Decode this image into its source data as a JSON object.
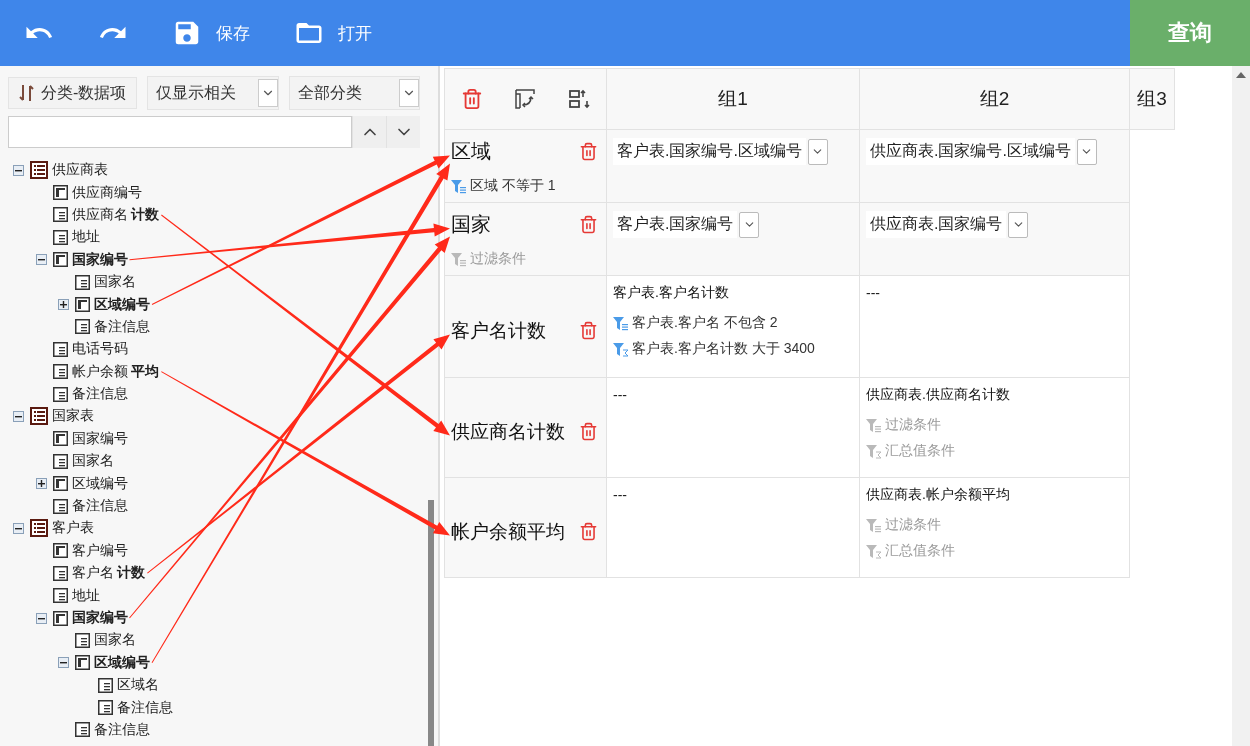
{
  "toolbar": {
    "buttons": [
      {
        "kind": "undo"
      },
      {
        "kind": "redo"
      },
      {
        "kind": "save",
        "label": "保存"
      },
      {
        "kind": "open",
        "label": "打开"
      }
    ],
    "query_button": "查询"
  },
  "left_panel": {
    "category_button": "分类-数据项",
    "filter_select": "仅显示相关",
    "category_select": "全部分类",
    "tree": [
      {
        "kind": "table",
        "label": "供应商表",
        "highlighted": false,
        "expanded": true,
        "children": [
          {
            "kind": "key",
            "label": "供应商编号",
            "highlighted": false
          },
          {
            "kind": "field",
            "label": "供应商名 **计数**",
            "highlighted": false
          },
          {
            "kind": "field",
            "label": "地址",
            "highlighted": false
          },
          {
            "kind": "key",
            "label": "国家编号",
            "highlighted": true,
            "expanded": true,
            "children": [
              {
                "kind": "field",
                "label": "国家名",
                "highlighted": false
              },
              {
                "kind": "key",
                "label": "区域编号",
                "highlighted": true,
                "expanded": false
              },
              {
                "kind": "field",
                "label": "备注信息",
                "highlighted": false
              }
            ]
          },
          {
            "kind": "field",
            "label": "电话号码",
            "highlighted": false
          },
          {
            "kind": "field",
            "label": "帐户余额 **平均**",
            "highlighted": false
          },
          {
            "kind": "field",
            "label": "备注信息",
            "highlighted": false
          }
        ]
      },
      {
        "kind": "table",
        "label": "国家表",
        "highlighted": false,
        "expanded": true,
        "children": [
          {
            "kind": "key",
            "label": "国家编号",
            "highlighted": false
          },
          {
            "kind": "field",
            "label": "国家名",
            "highlighted": false
          },
          {
            "kind": "key",
            "label": "区域编号",
            "highlighted": false,
            "expanded": false
          },
          {
            "kind": "field",
            "label": "备注信息",
            "highlighted": false
          }
        ]
      },
      {
        "kind": "table",
        "label": "客户表",
        "highlighted": false,
        "expanded": true,
        "children": [
          {
            "kind": "key",
            "label": "客户编号",
            "highlighted": false
          },
          {
            "kind": "field",
            "label": "客户名 **计数**",
            "highlighted": false
          },
          {
            "kind": "field",
            "label": "地址",
            "highlighted": false
          },
          {
            "kind": "key",
            "label": "国家编号",
            "highlighted": true,
            "expanded": true,
            "children": [
              {
                "kind": "field",
                "label": "国家名",
                "highlighted": false
              },
              {
                "kind": "key",
                "label": "区域编号",
                "highlighted": true,
                "expanded": true,
                "children": [
                  {
                    "kind": "field",
                    "label": "区域名",
                    "highlighted": false
                  },
                  {
                    "kind": "field",
                    "label": "备注信息",
                    "highlighted": false
                  }
                ]
              },
              {
                "kind": "field",
                "label": "备注信息",
                "highlighted": false
              }
            ]
          }
        ]
      }
    ]
  },
  "grid": {
    "tools": [
      {
        "kind": "delete"
      },
      {
        "kind": "pivot"
      },
      {
        "kind": "sort"
      }
    ],
    "groups": [
      "组1",
      "组2",
      "组3"
    ],
    "rows": [
      {
        "kind": "dimension",
        "label": "区域",
        "filter": {
          "text": "区域 不等于 1",
          "active": true
        },
        "cells": [
          {
            "kind": "select",
            "value": "客户表.国家编号.区域编号"
          },
          {
            "kind": "select",
            "value": "供应商表.国家编号.区域编号"
          }
        ]
      },
      {
        "kind": "dimension",
        "label": "国家",
        "filter": {
          "text": "过滤条件",
          "active": false
        },
        "cells": [
          {
            "kind": "select",
            "value": "客户表.国家编号"
          },
          {
            "kind": "select",
            "value": "供应商表.国家编号"
          }
        ]
      },
      {
        "kind": "measure",
        "label": "客户名计数",
        "cells": [
          {
            "kind": "measure",
            "title": "客户表.客户名计数",
            "filters": [
              {
                "kind": "row",
                "text": "客户表.客户名 不包含 2",
                "active": true
              },
              {
                "kind": "sum",
                "text": "客户表.客户名计数 大于 3400",
                "active": true
              }
            ]
          },
          {
            "kind": "empty",
            "text": "---"
          }
        ]
      },
      {
        "kind": "measure",
        "label": "供应商名计数",
        "cells": [
          {
            "kind": "empty",
            "text": "---"
          },
          {
            "kind": "measure",
            "title": "供应商表.供应商名计数",
            "filters": [
              {
                "kind": "row",
                "text": "过滤条件",
                "active": false
              },
              {
                "kind": "sum",
                "text": "汇总值条件",
                "active": false
              }
            ]
          }
        ]
      },
      {
        "kind": "measure",
        "label": "帐户余额平均",
        "cells": [
          {
            "kind": "empty",
            "text": "---"
          },
          {
            "kind": "measure",
            "title": "供应商表.帐户余额平均",
            "filters": [
              {
                "kind": "row",
                "text": "过滤条件",
                "active": false
              },
              {
                "kind": "sum",
                "text": "汇总值条件",
                "active": false
              }
            ]
          }
        ]
      }
    ]
  }
}
